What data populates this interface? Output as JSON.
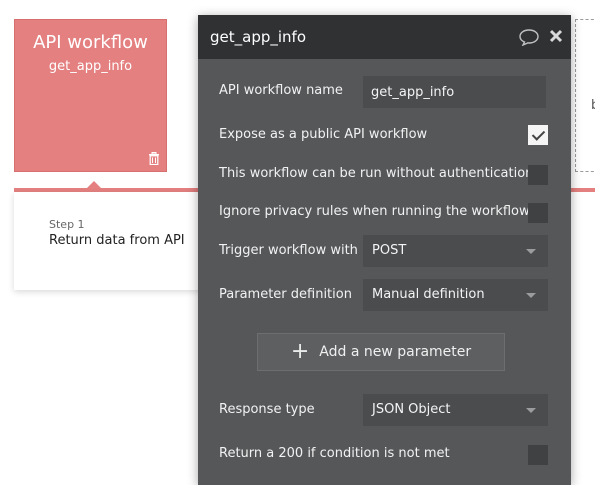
{
  "workflow_card": {
    "title": "API workflow",
    "subtitle": "get_app_info"
  },
  "step": {
    "label": "Step 1",
    "title": "Return data from API"
  },
  "background_partial_text": "b",
  "panel": {
    "title": "get_app_info",
    "api_name_label": "API workflow name",
    "api_name_value": "get_app_info",
    "expose_label": "Expose as a public API workflow",
    "expose_checked": true,
    "no_auth_label": "This workflow can be run without authentication",
    "no_auth_checked": false,
    "ignore_privacy_label": "Ignore privacy rules when running the workflow",
    "ignore_privacy_checked": false,
    "trigger_label": "Trigger workflow with",
    "trigger_value": "POST",
    "param_label": "Parameter definition",
    "param_value": "Manual definition",
    "add_param_label": "Add a new parameter",
    "response_label": "Response type",
    "response_value": "JSON Object",
    "return200_label": "Return a 200 if condition is not met",
    "return200_checked": false
  },
  "colors": {
    "workflow_card": "#e48080",
    "panel_bg": "#555759",
    "panel_header": "#2f3133",
    "field_bg": "#4a4c4e"
  },
  "icons": [
    "trash-icon",
    "comment-icon",
    "close-icon",
    "plus-icon",
    "chevron-down-icon",
    "checkmark-icon"
  ]
}
